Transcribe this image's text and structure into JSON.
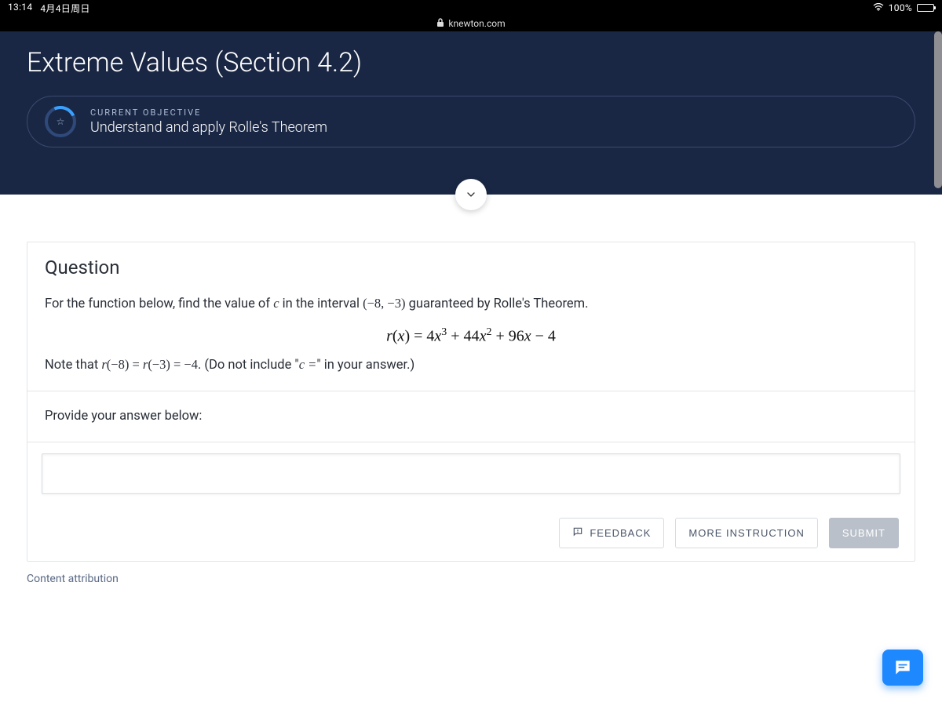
{
  "status": {
    "time": "13:14",
    "date": "4月4日周日",
    "battery": "100%"
  },
  "browser": {
    "host": "knewton.com"
  },
  "header": {
    "title": "Extreme Values (Section 4.2)",
    "objective_label": "CURRENT OBJECTIVE",
    "objective_text": "Understand and apply Rolle's Theorem"
  },
  "question": {
    "heading": "Question",
    "prompt_pre": "For the function below, find the value of ",
    "prompt_var": "c",
    "prompt_mid": " in the interval ",
    "interval": "(−8, −3)",
    "prompt_post": " guaranteed by Rolle's Theorem.",
    "formula": "r(x) = 4x³ + 44x² + 96x − 4",
    "note_pre": "Note that ",
    "note_eq": "r(−8) = r(−3) = −4",
    "note_post": ". (Do not include \"",
    "note_var": "c =",
    "note_final": "\" in your answer.)",
    "provide_label": "Provide your answer below:"
  },
  "answer": {
    "value": "",
    "placeholder": ""
  },
  "actions": {
    "feedback": "FEEDBACK",
    "more": "MORE INSTRUCTION",
    "submit": "SUBMIT"
  },
  "footer": {
    "attribution": "Content attribution"
  }
}
